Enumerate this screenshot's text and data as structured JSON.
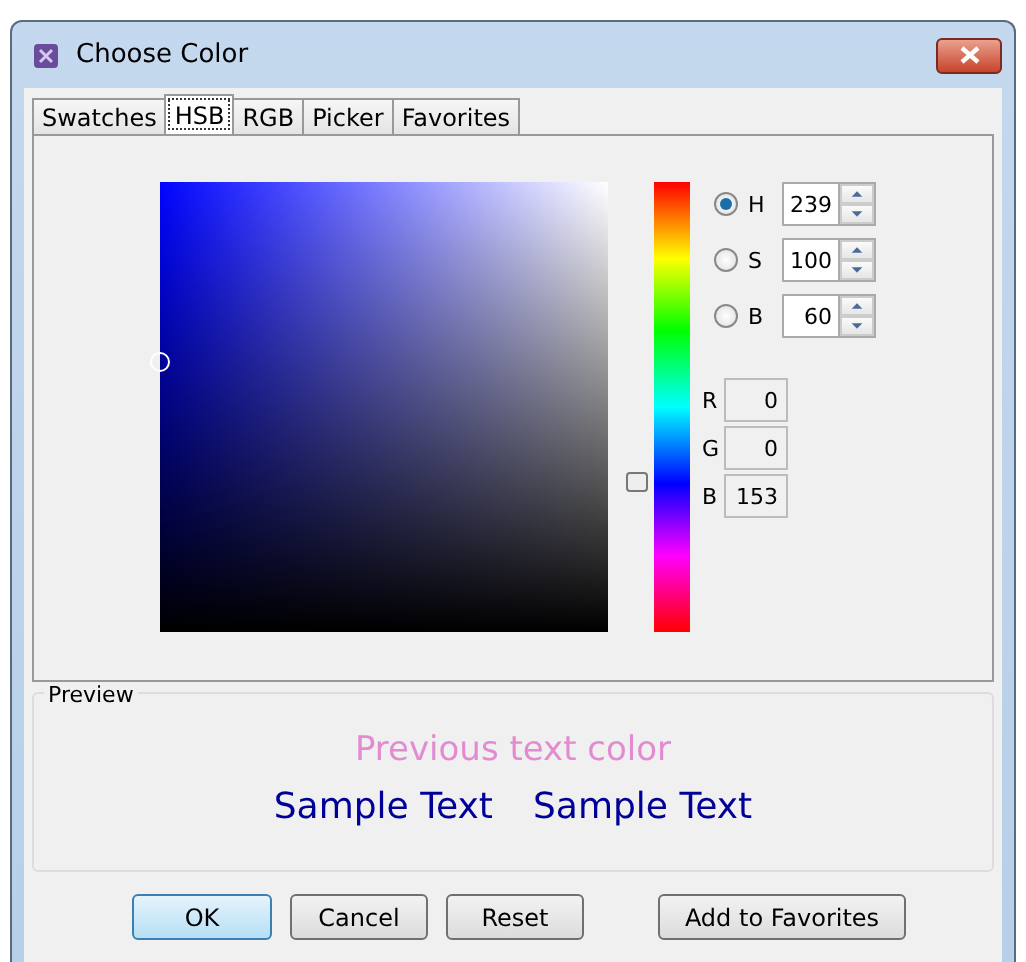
{
  "window": {
    "title": "Choose Color"
  },
  "tabs": [
    {
      "label": "Swatches",
      "selected": false
    },
    {
      "label": "HSB",
      "selected": true
    },
    {
      "label": "RGB",
      "selected": false
    },
    {
      "label": "Picker",
      "selected": false
    },
    {
      "label": "Favorites",
      "selected": false
    }
  ],
  "hsb_fields": [
    {
      "label": "H",
      "value": "239",
      "selected": true
    },
    {
      "label": "S",
      "value": "100",
      "selected": false
    },
    {
      "label": "B",
      "value": "60",
      "selected": false
    }
  ],
  "rgb_fields": [
    {
      "label": "R",
      "value": "0"
    },
    {
      "label": "G",
      "value": "0"
    },
    {
      "label": "B",
      "value": "153"
    }
  ],
  "preview": {
    "title": "Preview",
    "previous_text": "Previous text color",
    "samples": [
      "Sample Text",
      "Sample Text"
    ]
  },
  "buttons": [
    {
      "label": "OK",
      "kind": "default"
    },
    {
      "label": "Cancel",
      "kind": "normal"
    },
    {
      "label": "Reset",
      "kind": "normal"
    },
    {
      "label": "Add to Favorites",
      "kind": "wide"
    }
  ]
}
